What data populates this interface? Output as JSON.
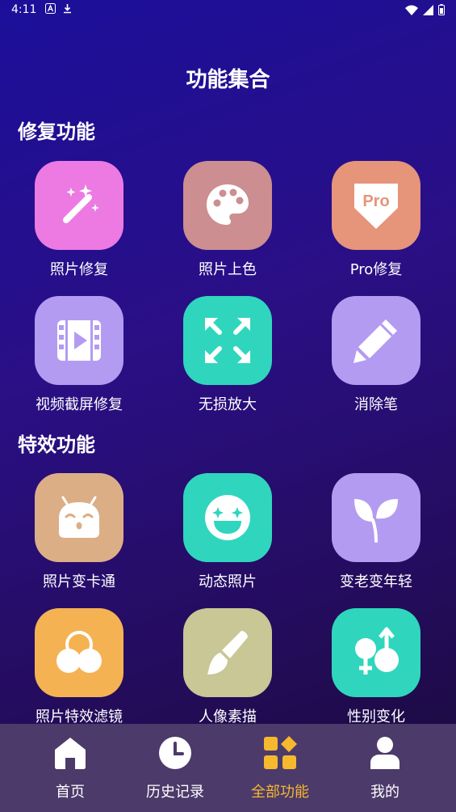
{
  "status": {
    "time": "4:11"
  },
  "title": "功能集合",
  "sections": [
    {
      "title": "修复功能",
      "items": [
        {
          "label": "照片修复",
          "icon": "magic-wand-icon",
          "color": "#ec7ae2"
        },
        {
          "label": "照片上色",
          "icon": "palette-icon",
          "color": "#cc8e90"
        },
        {
          "label": "Pro修复",
          "icon": "pro-badge-icon",
          "color": "#e6947a"
        },
        {
          "label": "视频截屏修复",
          "icon": "video-film-icon",
          "color": "#b39bf1"
        },
        {
          "label": "无损放大",
          "icon": "expand-arrows-icon",
          "color": "#2fd6bd"
        },
        {
          "label": "消除笔",
          "icon": "pencil-icon",
          "color": "#b39bf1"
        }
      ]
    },
    {
      "title": "特效功能",
      "items": [
        {
          "label": "照片变卡通",
          "icon": "cartoon-face-icon",
          "color": "#dcae86"
        },
        {
          "label": "动态照片",
          "icon": "laughing-face-icon",
          "color": "#2fd6bd"
        },
        {
          "label": "变老变年轻",
          "icon": "sprout-icon",
          "color": "#b39bf1"
        },
        {
          "label": "照片特效滤镜",
          "icon": "circles-filter-icon",
          "color": "#f5b253"
        },
        {
          "label": "人像素描",
          "icon": "paint-brush-icon",
          "color": "#c8c795"
        },
        {
          "label": "性别变化",
          "icon": "gender-icon",
          "color": "#2fd6bd"
        }
      ]
    }
  ],
  "nav": [
    {
      "label": "首页",
      "icon": "home-icon",
      "active": false
    },
    {
      "label": "历史记录",
      "icon": "clock-icon",
      "active": false
    },
    {
      "label": "全部功能",
      "icon": "grid-apps-icon",
      "active": true
    },
    {
      "label": "我的",
      "icon": "user-icon",
      "active": false
    }
  ],
  "colors": {
    "nav_active": "#f5b82e",
    "nav_inactive": "#ffffff",
    "nav_bg": "#4c3a6a"
  }
}
